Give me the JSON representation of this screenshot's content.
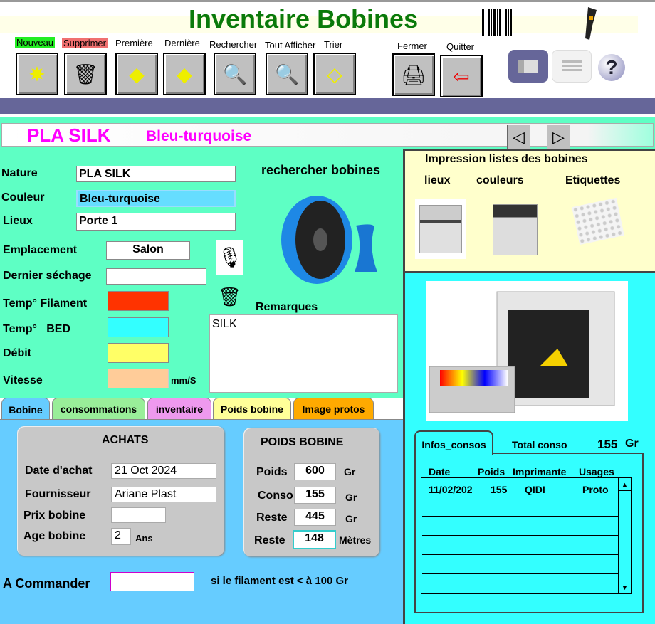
{
  "header": {
    "title": "Inventaire Bobines"
  },
  "toolbar": {
    "buttons": [
      {
        "label": "Nouveau",
        "icon": "new-record-icon"
      },
      {
        "label": "Supprimer",
        "icon": "delete-record-icon"
      },
      {
        "label": "Première",
        "icon": "first-record-icon"
      },
      {
        "label": "Dernière",
        "icon": "last-record-icon"
      },
      {
        "label": "Rechercher",
        "icon": "search-icon"
      },
      {
        "label": "Tout Afficher",
        "icon": "show-all-icon"
      },
      {
        "label": "Trier",
        "icon": "sort-icon"
      },
      {
        "label": "Fermer",
        "icon": "close-icon"
      },
      {
        "label": "Quitter",
        "icon": "exit-icon"
      }
    ]
  },
  "record": {
    "title": "PLA SILK",
    "subtitle": "Bleu-turquoise"
  },
  "form": {
    "nature_label": "Nature",
    "nature": "PLA SILK",
    "couleur_label": "Couleur",
    "couleur": "Bleu-turquoise",
    "lieux_label": "Lieux",
    "lieux": "Porte 1",
    "emplacement_label": "Emplacement",
    "emplacement": "Salon",
    "sechage_label": "Dernier séchage",
    "sechage": "",
    "temp_fil_label": "Temp° Filament",
    "temp_bed_label": "Temp°   BED",
    "debit_label": "Débit",
    "vitesse_label": "Vitesse",
    "vitesse_unit": "mm/S",
    "rechercher_label": "rechercher bobines",
    "remarques_label": "Remarques",
    "remarques": "SILK",
    "colors": {
      "filament": "#ff3300",
      "bed": "#33ffff",
      "debit": "#ffff66",
      "vitesse": "#ffcc99"
    }
  },
  "tabs": [
    {
      "label": "Bobine",
      "color": "#66ccff"
    },
    {
      "label": "consommations",
      "color": "#99ee99"
    },
    {
      "label": "inventaire",
      "color": "#ee99ee"
    },
    {
      "label": "Poids bobine",
      "color": "#ffff99"
    },
    {
      "label": "Image protos",
      "color": "#ffaa00"
    }
  ],
  "achats": {
    "title": "ACHATS",
    "date_label": "Date d'achat",
    "date": "21 Oct 2024",
    "fournisseur_label": "Fournisseur",
    "fournisseur": "Ariane Plast",
    "prix_label": "Prix bobine",
    "prix": "",
    "age_label": "Age bobine",
    "age": "2",
    "age_unit": "Ans"
  },
  "poids": {
    "title": "POIDS BOBINE",
    "poids_label": "Poids",
    "poids": "600",
    "conso_label": "Conso",
    "conso": "155",
    "reste_label": "Reste",
    "reste": "445",
    "reste_m_label": "Reste",
    "reste_m": "148",
    "gr": "Gr",
    "metres": "Mètres"
  },
  "commander": {
    "label": "A Commander",
    "value": "",
    "note": "si le filament est < à 100 Gr"
  },
  "impression": {
    "title": "Impression listes des bobines",
    "lieux": "lieux",
    "couleurs": "couleurs",
    "etiquettes": "Etiquettes"
  },
  "consos": {
    "tab": "Infos_consos",
    "total_label": "Total conso",
    "total": "155",
    "unit": "Gr",
    "columns": [
      "Date",
      "Poids",
      "Imprimante",
      "Usages"
    ],
    "rows": [
      {
        "date": "11/02/202",
        "poids": "155",
        "imprimante": "QIDI",
        "usage": "Proto"
      }
    ]
  }
}
